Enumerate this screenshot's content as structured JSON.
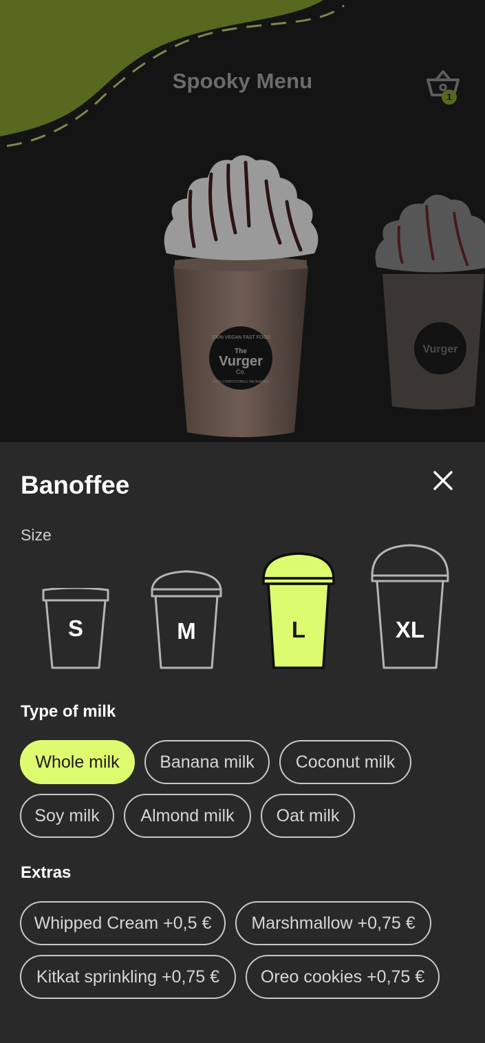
{
  "header": {
    "title": "Spooky Menu",
    "cart_count": "1",
    "cart_icon": "basket-icon"
  },
  "colors": {
    "accent": "#ddfb6e",
    "blob": "#56691f",
    "sheet_bg": "#292929",
    "page_bg": "#141414"
  },
  "hero": {
    "cup_logo_top": "100% VEGAN FAST FOOD",
    "cup_logo_brand_1": "The",
    "cup_logo_brand_2": "Vurger",
    "cup_logo_brand_3": "Co.",
    "cup_logo_bottom": "100% COMPOSTABLE PACKAGING"
  },
  "product": {
    "name": "Banoffee",
    "close_icon": "close-icon",
    "size_label": "Size",
    "sizes": [
      {
        "label": "S",
        "selected": false
      },
      {
        "label": "M",
        "selected": false
      },
      {
        "label": "L",
        "selected": true
      },
      {
        "label": "XL",
        "selected": false
      }
    ],
    "milk_title": "Type of milk",
    "milks": [
      {
        "label": "Whole milk",
        "selected": true
      },
      {
        "label": "Banana milk",
        "selected": false
      },
      {
        "label": "Coconut milk",
        "selected": false
      },
      {
        "label": "Soy milk",
        "selected": false
      },
      {
        "label": "Almond milk",
        "selected": false
      },
      {
        "label": "Oat milk",
        "selected": false
      }
    ],
    "extras_title": "Extras",
    "extras": [
      {
        "label": "Whipped Cream +0,5 €"
      },
      {
        "label": "Marshmallow +0,75 €"
      },
      {
        "label": "Kitkat sprinkling +0,75 €"
      },
      {
        "label": "Oreo cookies +0,75 €"
      }
    ]
  }
}
